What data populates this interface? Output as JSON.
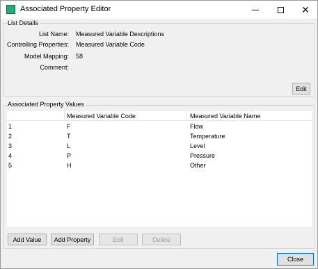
{
  "window": {
    "title": "Associated Property Editor",
    "accent": "#1fae74"
  },
  "list_details": {
    "group_title": "List Details",
    "fields": [
      {
        "label": "List Name:",
        "value": "Measured Variable Descriptions"
      },
      {
        "label": "Controlling Properties:",
        "value": "Measured Variable Code"
      },
      {
        "label": "Model Mapping:",
        "value": "58"
      },
      {
        "label": "Comment:",
        "value": ""
      }
    ],
    "edit_label": "Edit"
  },
  "property_values": {
    "group_title": "Associated Property Values",
    "columns": [
      "",
      "Measured Variable Code",
      "Measured Variable Name"
    ],
    "rows": [
      {
        "index": "1",
        "code": "F",
        "name": "Flow"
      },
      {
        "index": "2",
        "code": "T",
        "name": "Temperature"
      },
      {
        "index": "3",
        "code": "L",
        "name": "Level"
      },
      {
        "index": "4",
        "code": "P",
        "name": "Pressure"
      },
      {
        "index": "5",
        "code": "H",
        "name": "Other"
      }
    ],
    "buttons": {
      "add_value": "Add Value",
      "add_property": "Add Property",
      "edit": "Edit",
      "delete": "Delete"
    }
  },
  "footer": {
    "close_label": "Close"
  }
}
